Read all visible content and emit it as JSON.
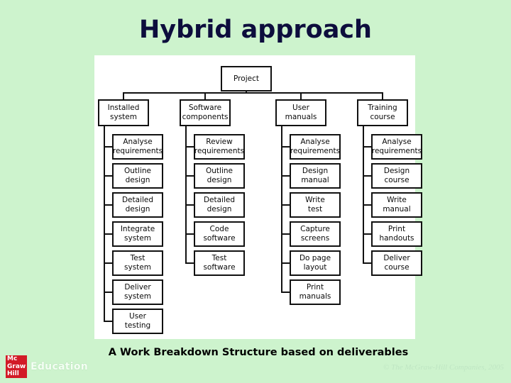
{
  "slide": {
    "title": "Hybrid approach",
    "caption": "A Work Breakdown Structure based on deliverables",
    "background_color": "#cdf3cd",
    "title_color": "#0d0d3d",
    "panel_color": "#ffffff"
  },
  "footer": {
    "logo_line1": "Mc",
    "logo_line2": "Graw",
    "logo_line3": "Hill",
    "logo_color": "#d21b27",
    "brand_word": "Education",
    "copyright": "© The McGraw-Hill Companies, 2005"
  },
  "diagram": {
    "root": {
      "line1": "Project",
      "line2": ""
    },
    "branches": [
      {
        "line1": "Installed",
        "line2": "system",
        "children": [
          {
            "line1": "Analyse",
            "line2": "requirements"
          },
          {
            "line1": "Outline",
            "line2": "design"
          },
          {
            "line1": "Detailed",
            "line2": "design"
          },
          {
            "line1": "Integrate",
            "line2": "system"
          },
          {
            "line1": "Test",
            "line2": "system"
          },
          {
            "line1": "Deliver",
            "line2": "system"
          },
          {
            "line1": "User",
            "line2": "testing"
          }
        ]
      },
      {
        "line1": "Software",
        "line2": "components",
        "children": [
          {
            "line1": "Review",
            "line2": "requirements"
          },
          {
            "line1": "Outline",
            "line2": "design"
          },
          {
            "line1": "Detailed",
            "line2": "design"
          },
          {
            "line1": "Code",
            "line2": "software"
          },
          {
            "line1": "Test",
            "line2": "software"
          }
        ]
      },
      {
        "line1": "User",
        "line2": "manuals",
        "children": [
          {
            "line1": "Analyse",
            "line2": "requirements"
          },
          {
            "line1": "Design",
            "line2": "manual"
          },
          {
            "line1": "Write",
            "line2": "test"
          },
          {
            "line1": "Capture",
            "line2": "screens"
          },
          {
            "line1": "Do page",
            "line2": "layout"
          },
          {
            "line1": "Print",
            "line2": "manuals"
          }
        ]
      },
      {
        "line1": "Training",
        "line2": "course",
        "children": [
          {
            "line1": "Analyse",
            "line2": "requirements"
          },
          {
            "line1": "Design",
            "line2": "course"
          },
          {
            "line1": "Write",
            "line2": "manual"
          },
          {
            "line1": "Print",
            "line2": "handouts"
          },
          {
            "line1": "Deliver",
            "line2": "course"
          }
        ]
      }
    ]
  }
}
